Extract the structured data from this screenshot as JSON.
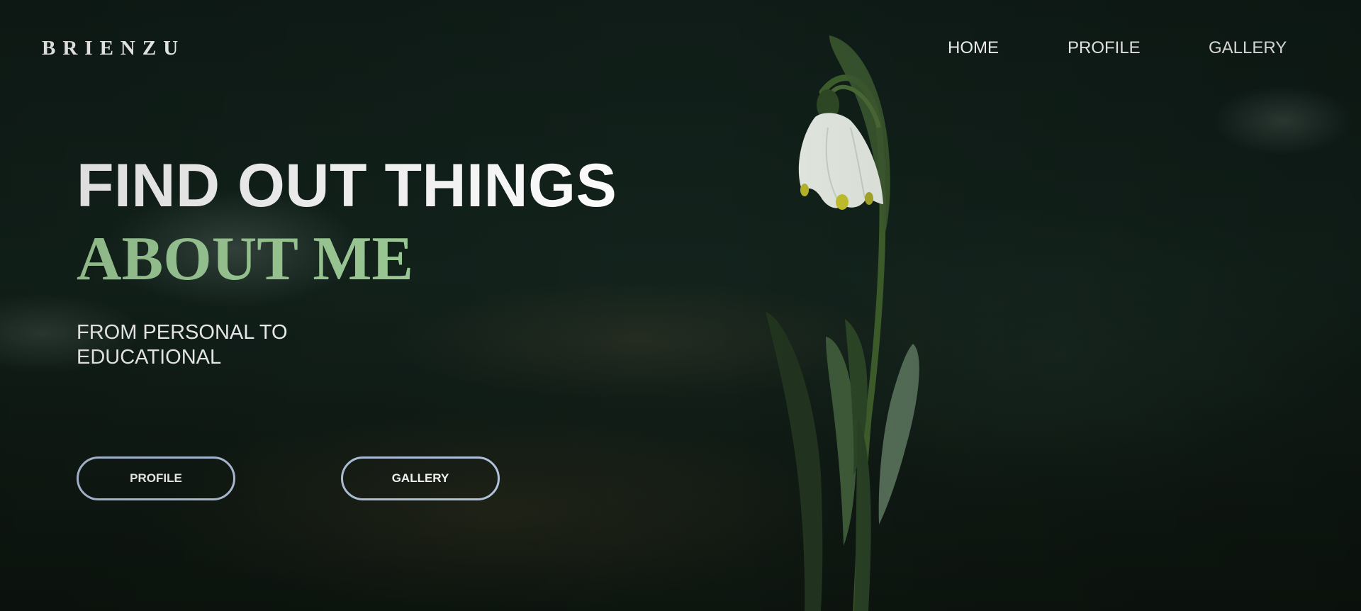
{
  "brand": {
    "name": "BRIENZU"
  },
  "nav": {
    "items": [
      {
        "label": "HOME"
      },
      {
        "label": "PROFILE"
      },
      {
        "label": "GALLERY"
      }
    ]
  },
  "hero": {
    "headline_line1": "FIND OUT THINGS",
    "headline_line2": "ABOUT ME",
    "subtitle_line1": "FROM PERSONAL TO",
    "subtitle_line2": "EDUCATIONAL",
    "buttons": [
      {
        "label": "PROFILE"
      },
      {
        "label": "GALLERY"
      }
    ]
  },
  "colors": {
    "accent_green": "#a3d39c",
    "button_border": "#b7c9e3",
    "background": "#13231c",
    "text": "#ffffff"
  }
}
